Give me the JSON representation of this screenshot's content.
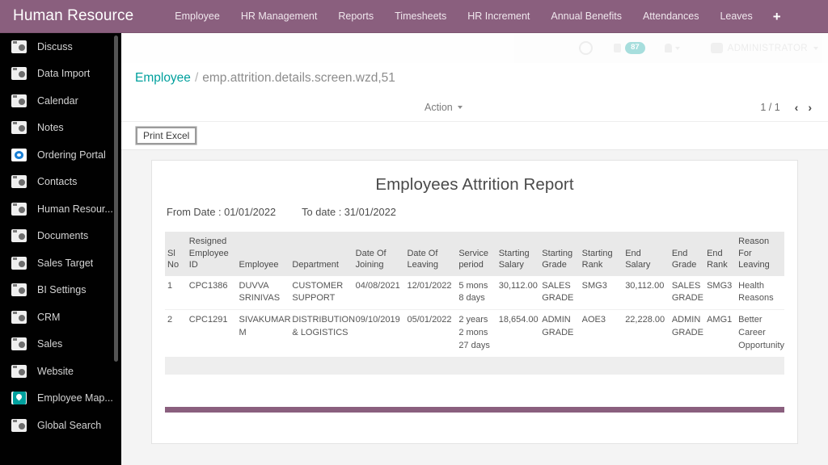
{
  "navbar": {
    "brand": "Human Resource",
    "items": [
      {
        "label": "Employee"
      },
      {
        "label": "HR Management"
      },
      {
        "label": "Reports"
      },
      {
        "label": "Timesheets"
      },
      {
        "label": "HR Increment"
      },
      {
        "label": "Annual Benefits"
      },
      {
        "label": "Attendances"
      },
      {
        "label": "Leaves"
      }
    ],
    "add_label": "+"
  },
  "systray": {
    "message_count": "87",
    "user_name": "ADMINISTRATOR"
  },
  "sidebar": {
    "items": [
      {
        "label": "Discuss",
        "icon": "generic"
      },
      {
        "label": "Data Import",
        "icon": "generic"
      },
      {
        "label": "Calendar",
        "icon": "generic"
      },
      {
        "label": "Notes",
        "icon": "generic"
      },
      {
        "label": "Ordering Portal",
        "icon": "portal"
      },
      {
        "label": "Contacts",
        "icon": "generic"
      },
      {
        "label": "Human Resour...",
        "icon": "generic"
      },
      {
        "label": "Documents",
        "icon": "generic"
      },
      {
        "label": "Sales Target",
        "icon": "generic"
      },
      {
        "label": "BI Settings",
        "icon": "generic"
      },
      {
        "label": "CRM",
        "icon": "generic"
      },
      {
        "label": "Sales",
        "icon": "generic"
      },
      {
        "label": "Website",
        "icon": "generic"
      },
      {
        "label": "Employee Map...",
        "icon": "map"
      },
      {
        "label": "Global Search",
        "icon": "generic"
      }
    ]
  },
  "breadcrumb": {
    "root": "Employee",
    "separator": "/",
    "current": "emp.attrition.details.screen.wzd,51"
  },
  "controls": {
    "action_label": "Action",
    "pager_count": "1 / 1",
    "prev_arrow": "‹",
    "next_arrow": "›",
    "print_excel_label": "Print Excel"
  },
  "report": {
    "title": "Employees Attrition Report",
    "from_date_label": "From Date : 01/01/2022",
    "to_date_label": "To date : 31/01/2022",
    "columns": [
      "Sl No",
      "Resigned Employee ID",
      "Employee",
      "Department",
      "Date Of Joining",
      "Date Of Leaving",
      "Service period",
      "Starting Salary",
      "Starting Grade",
      "Starting Rank",
      "End Salary",
      "End Grade",
      "End Rank",
      "Reason For Leaving"
    ],
    "rows": [
      {
        "sl_no": "1",
        "resigned_employee_id": "CPC1386",
        "employee": "DUVVA SRINIVAS",
        "department": "CUSTOMER SUPPORT",
        "date_of_joining": "04/08/2021",
        "date_of_leaving": "12/01/2022",
        "service_period": "5 mons 8 days",
        "starting_salary": "30,112.00",
        "starting_grade": "SALES GRADE",
        "starting_rank": "SMG3",
        "end_salary": "30,112.00",
        "end_grade": "SALES GRADE",
        "end_rank": "SMG3",
        "reason_for_leaving": "Health Reasons"
      },
      {
        "sl_no": "2",
        "resigned_employee_id": "CPC1291",
        "employee": "SIVAKUMAR M",
        "department": "DISTRIBUTION & LOGISTICS",
        "date_of_joining": "09/10/2019",
        "date_of_leaving": "05/01/2022",
        "service_period": "2 years 2 mons 27 days",
        "starting_salary": "18,654.00",
        "starting_grade": "ADMIN GRADE",
        "starting_rank": "AOE3",
        "end_salary": "22,228.00",
        "end_grade": "ADMIN GRADE",
        "end_rank": "AMG1",
        "reason_for_leaving": "Better Career Opportunity"
      }
    ]
  },
  "colors": {
    "brand_purple": "#8a5f7e",
    "accent_teal": "#00a09d",
    "sidebar_bg": "#010101",
    "table_header_bg": "#e9e9e9"
  }
}
